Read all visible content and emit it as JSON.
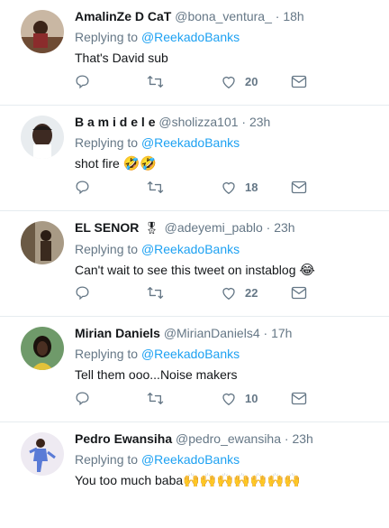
{
  "tweets": [
    {
      "name": "AmalinZe D CaT",
      "handle": "@bona_ventura_",
      "time": "18h",
      "reply_prefix": "Replying to",
      "reply_to": "@ReekadoBanks",
      "text": "That's David sub",
      "emoji": "",
      "likes": "20",
      "avatar_color": "#8b5a3c",
      "avatar_icon": "person-photo-icon"
    },
    {
      "name": "B a m i d e l e",
      "handle": "@sholizza101",
      "time": "23h",
      "reply_prefix": "Replying to",
      "reply_to": "@ReekadoBanks",
      "text": "shot fire ",
      "emoji": "🤣🤣",
      "likes": "18",
      "avatar_color": "#cfd6dc",
      "avatar_icon": "person-photo-icon"
    },
    {
      "name": "EL SENOR",
      "badge": "🎖",
      "handle": "@adeyemi_pablo",
      "time": "23h",
      "reply_prefix": "Replying to",
      "reply_to": "@ReekadoBanks",
      "text": "Can't wait to see this tweet on instablog ",
      "emoji": "😂",
      "likes": "22",
      "avatar_color": "#6b5a45",
      "avatar_icon": "person-photo-icon"
    },
    {
      "name": "Mirian Daniels",
      "handle": "@MirianDaniels4",
      "time": "17h",
      "reply_prefix": "Replying to",
      "reply_to": "@ReekadoBanks",
      "text": "Tell them ooo...Noise makers",
      "emoji": "",
      "likes": "10",
      "avatar_color": "#3a6b45",
      "avatar_icon": "person-photo-icon"
    },
    {
      "name": "Pedro Ewansiha",
      "handle": "@pedro_ewansiha",
      "time": "23h",
      "reply_prefix": "Replying to",
      "reply_to": "@ReekadoBanks",
      "text": "You too much baba",
      "emoji": "🙌🙌🙌🙌🙌🙌🙌",
      "likes": "",
      "avatar_color": "#e8e4ef",
      "avatar_icon": "person-photo-icon"
    }
  ],
  "colors": {
    "link": "#1da1f2",
    "muted": "#657786",
    "text": "#14171a",
    "divider": "#e6ecf0"
  },
  "icons": {
    "reply": "reply-icon",
    "retweet": "retweet-icon",
    "like": "heart-icon",
    "message": "direct-message-icon"
  }
}
